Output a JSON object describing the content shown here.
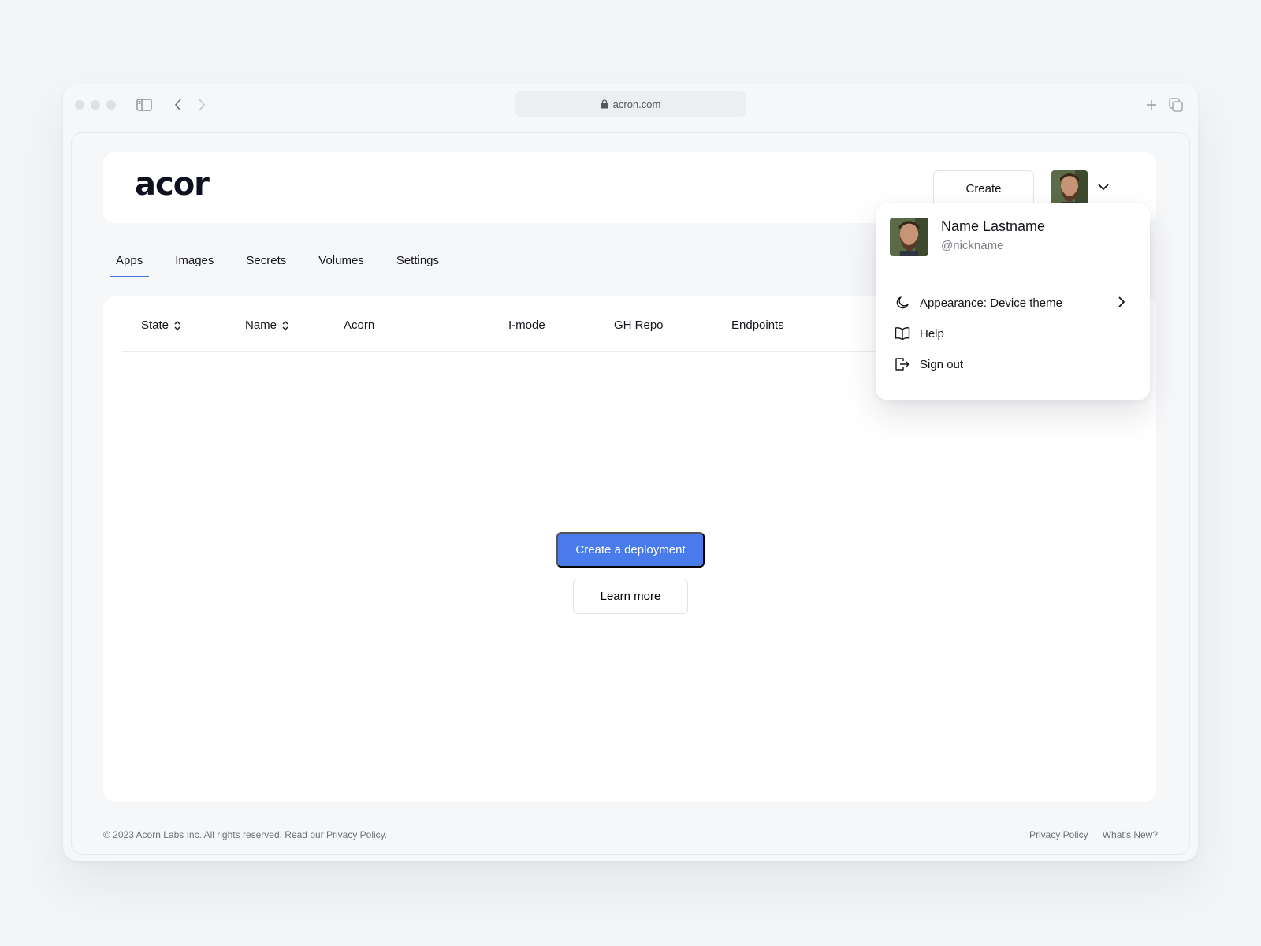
{
  "browser": {
    "url": "acron.com"
  },
  "header": {
    "logo_text": "acor",
    "create_label": "Create"
  },
  "tabs": [
    {
      "label": "Apps",
      "active": true
    },
    {
      "label": "Images",
      "active": false
    },
    {
      "label": "Secrets",
      "active": false
    },
    {
      "label": "Volumes",
      "active": false
    },
    {
      "label": "Settings",
      "active": false
    }
  ],
  "table": {
    "columns": [
      {
        "label": "State",
        "sortable": true
      },
      {
        "label": "Name",
        "sortable": true
      },
      {
        "label": "Acorn",
        "sortable": false
      },
      {
        "label": "I-mode",
        "sortable": false
      },
      {
        "label": "GH Repo",
        "sortable": false
      },
      {
        "label": "Endpoints",
        "sortable": false
      }
    ]
  },
  "empty_state": {
    "primary_label": "Create a deployment",
    "secondary_label": "Learn more"
  },
  "footer": {
    "copyright": "© 2023 Acorn Labs Inc. All rights reserved. Read our Privacy Policy.",
    "links": [
      "Privacy Policy",
      "What's New?"
    ]
  },
  "user_menu": {
    "name": "Name Lastname",
    "nickname": "@nickname",
    "items": [
      {
        "label": "Appearance: Device theme",
        "icon": "moon-icon"
      },
      {
        "label": "Help",
        "icon": "book-icon"
      },
      {
        "label": "Sign out",
        "icon": "sign-out-icon"
      }
    ]
  },
  "colors": {
    "accent": "#4a7bea",
    "tab_underline": "#3f6fe0",
    "background": "#f4f5f8"
  }
}
